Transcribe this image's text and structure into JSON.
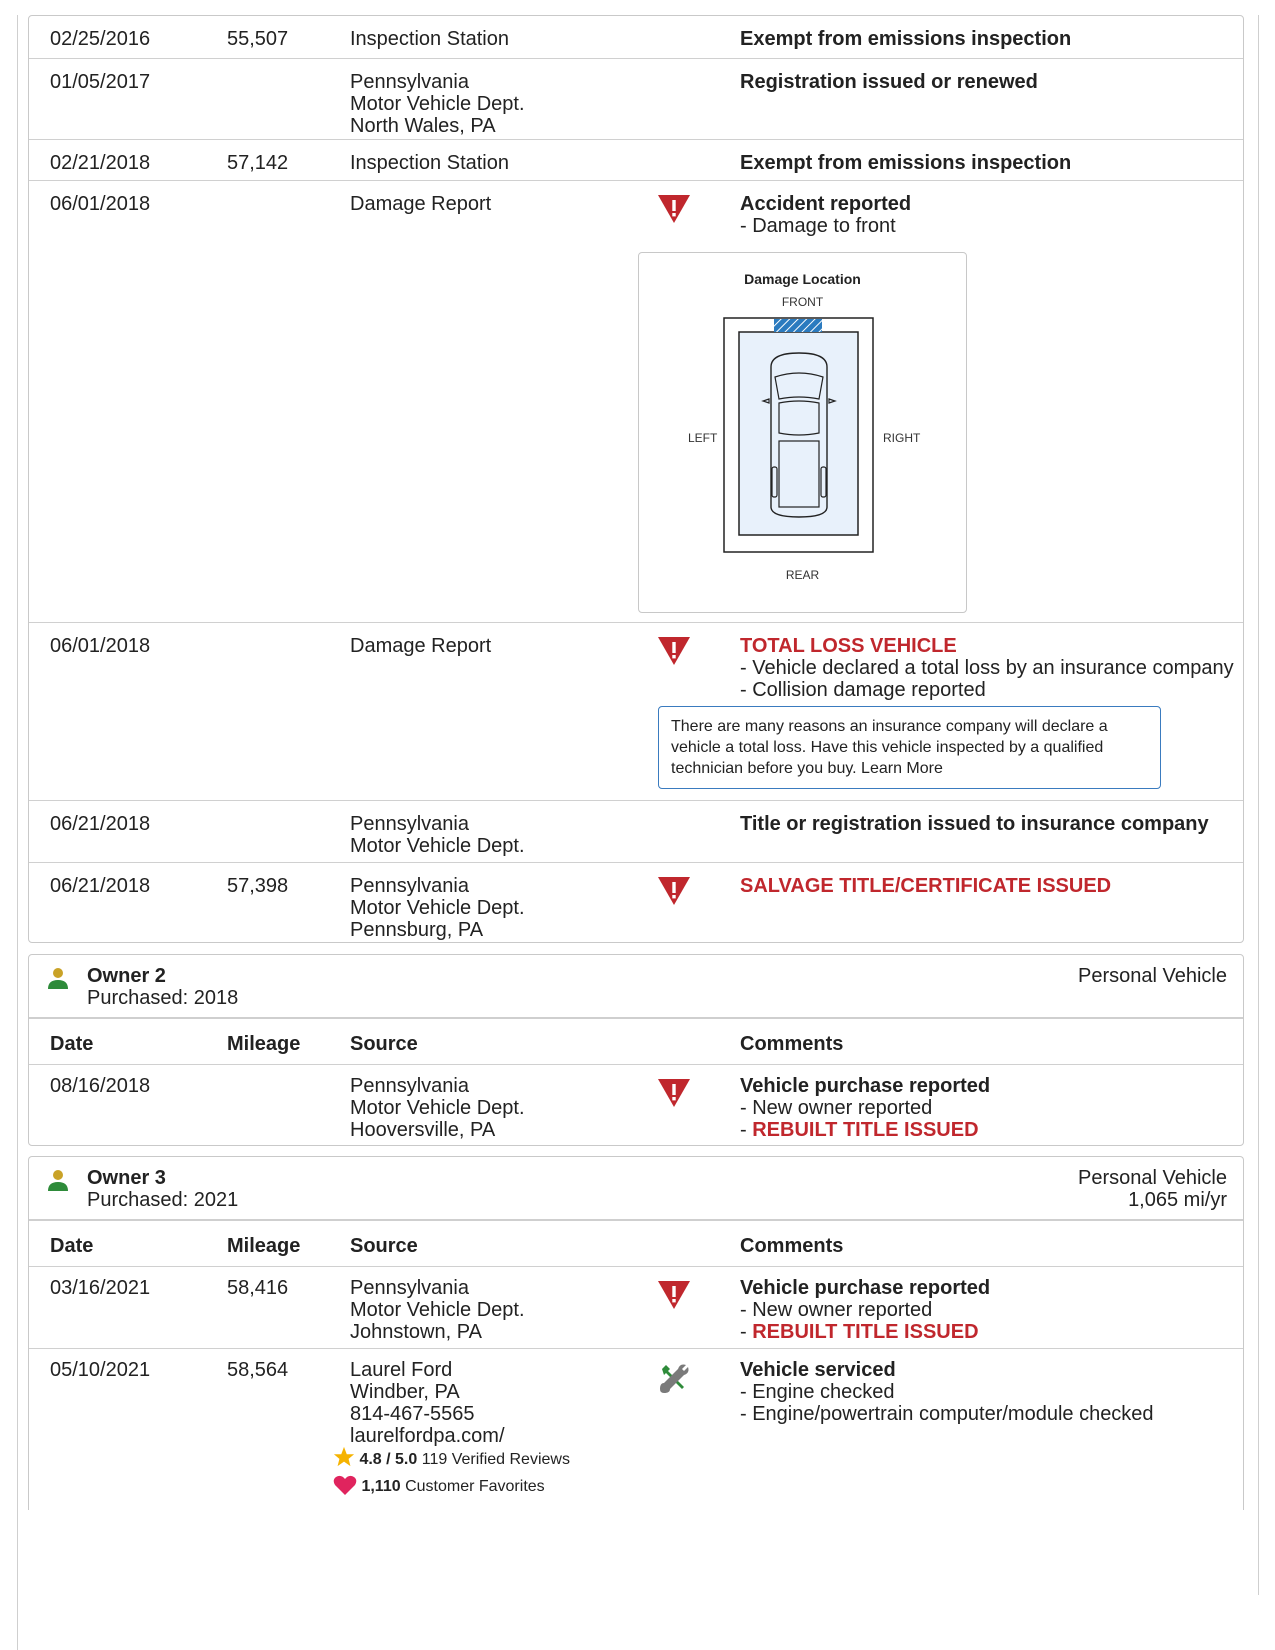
{
  "columns": {
    "date": "Date",
    "mileage": "Mileage",
    "source": "Source",
    "comments": "Comments"
  },
  "owner1_records": [
    {
      "date": "02/25/2016",
      "mileage": "55,507",
      "source": [
        "Inspection Station"
      ],
      "comments_title": "Exempt from emissions inspection"
    },
    {
      "date": "01/05/2017",
      "mileage": "",
      "source": [
        "Pennsylvania",
        "Motor Vehicle Dept.",
        "North Wales, PA"
      ],
      "comments_title": "Registration issued or renewed"
    },
    {
      "date": "02/21/2018",
      "mileage": "57,142",
      "source": [
        "Inspection Station"
      ],
      "comments_title": "Exempt from emissions inspection"
    },
    {
      "date": "06/01/2018",
      "mileage": "",
      "source": [
        "Damage Report"
      ],
      "comments_title": "Accident reported",
      "details": [
        "Damage to front"
      ]
    },
    {
      "date": "06/01/2018",
      "mileage": "",
      "source": [
        "Damage Report"
      ],
      "comments_title": "TOTAL LOSS VEHICLE",
      "details": [
        "Vehicle declared a total loss by an insurance company",
        "Collision damage reported"
      ]
    },
    {
      "date": "06/21/2018",
      "mileage": "",
      "source": [
        "Pennsylvania",
        "Motor Vehicle Dept."
      ],
      "comments_title": "Title or registration issued to insurance company"
    },
    {
      "date": "06/21/2018",
      "mileage": "57,398",
      "source": [
        "Pennsylvania",
        "Motor Vehicle Dept.",
        "Pennsburg, PA"
      ],
      "comments_title": "SALVAGE TITLE/CERTIFICATE ISSUED"
    }
  ],
  "damage_diagram": {
    "title": "Damage Location",
    "front": "FRONT",
    "rear": "REAR",
    "left": "LEFT",
    "right": "RIGHT",
    "damaged_area": "front"
  },
  "total_loss_info": "There are many reasons an insurance company will declare a vehicle a total loss. Have this vehicle inspected by a qualified technician before you buy. Learn More",
  "owner2": {
    "title": "Owner 2",
    "purchased": "Purchased: 2018",
    "type": "Personal Vehicle",
    "records": [
      {
        "date": "08/16/2018",
        "mileage": "",
        "source": [
          "Pennsylvania",
          "Motor Vehicle Dept.",
          "Hooversville, PA"
        ],
        "comments_title": "Vehicle purchase reported",
        "details": [
          "New owner reported"
        ],
        "alert": "REBUILT TITLE ISSUED"
      }
    ]
  },
  "owner3": {
    "title": "Owner 3",
    "purchased": "Purchased: 2021",
    "type": "Personal Vehicle",
    "usage": "1,065 mi/yr",
    "records": [
      {
        "date": "03/16/2021",
        "mileage": "58,416",
        "source": [
          "Pennsylvania",
          "Motor Vehicle Dept.",
          "Johnstown, PA"
        ],
        "comments_title": "Vehicle purchase reported",
        "details": [
          "New owner reported"
        ],
        "alert": "REBUILT TITLE ISSUED"
      },
      {
        "date": "05/10/2021",
        "mileage": "58,564",
        "source": [
          "Laurel Ford",
          "Windber, PA",
          "814-467-5565",
          "laurelfordpa.com/"
        ],
        "comments_title": "Vehicle serviced",
        "details": [
          "Engine checked",
          "Engine/powertrain computer/module checked"
        ],
        "rating": {
          "score": "4.8 / 5.0",
          "reviews": "119 Verified Reviews",
          "favorites_count": "1,110",
          "favorites_label": "Customer Favorites"
        }
      }
    ]
  },
  "colors": {
    "alert_red": "#c0272d",
    "info_blue": "#3a7bbf",
    "damage_blue": "#2b7bbf",
    "owner_green": "#2e8b3a",
    "owner_gold": "#c9a227",
    "star": "#f5b301",
    "heart": "#e0245e"
  },
  "icons": {
    "alert": "warning-triangle-icon",
    "service": "wrench-screwdriver-icon",
    "owner": "person-icon",
    "star": "star-icon",
    "heart": "heart-icon"
  }
}
